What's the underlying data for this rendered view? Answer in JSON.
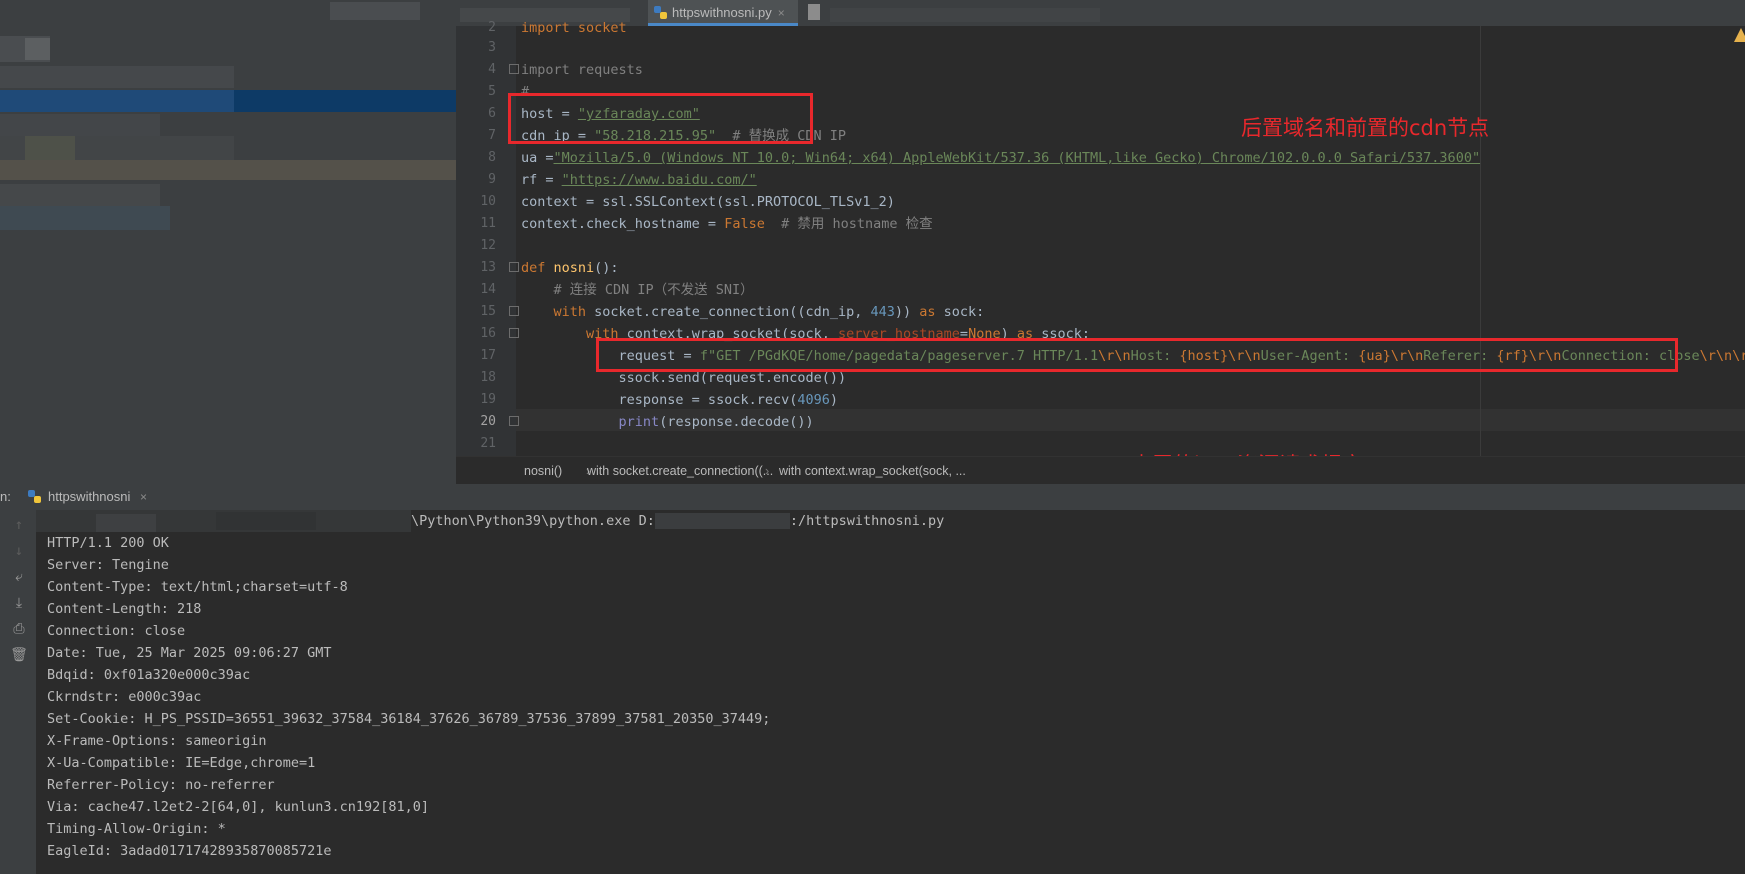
{
  "tabs": {
    "active_file": "httpswithnosni.py",
    "close_glyph": "×"
  },
  "editor": {
    "lines": [
      {
        "num": "3"
      },
      {
        "num": "4"
      },
      {
        "num": "5"
      },
      {
        "num": "6"
      },
      {
        "num": "7"
      },
      {
        "num": "8"
      },
      {
        "num": "9"
      },
      {
        "num": "10"
      },
      {
        "num": "11"
      },
      {
        "num": "12"
      },
      {
        "num": "13"
      },
      {
        "num": "14"
      },
      {
        "num": "15"
      },
      {
        "num": "16"
      },
      {
        "num": "17"
      },
      {
        "num": "18"
      },
      {
        "num": "19"
      },
      {
        "num": "20"
      },
      {
        "num": "21"
      }
    ],
    "code": {
      "l2": "import socket",
      "l4": "import requests",
      "l5": "#",
      "l6_a": "host = ",
      "l6_b": "\"yzfaraday.com\"",
      "l7_a": "cdn_ip = ",
      "l7_b": "\"58.218.215.95\"",
      "l7_c": "  # 替换成 CDN IP",
      "l8_a": "ua =",
      "l8_b": "\"Mozilla/5.0 (Windows NT 10.0; Win64; x64) AppleWebKit/537.36 (KHTML,like Gecko) Chrome/102.0.0.0 Safari/537.3600\"",
      "l9_a": "rf = ",
      "l9_b": "\"https://www.baidu.com/\"",
      "l10": "context = ssl.SSLContext(ssl.PROTOCOL_TLSv1_2)",
      "l11_a": "context.check_hostname = ",
      "l11_b": "False",
      "l11_c": "  # 禁用 hostname 检查",
      "l13_a": "def ",
      "l13_b": "nosni",
      "l13_c": "():",
      "l14": "    # 连接 CDN IP（不发送 SNI）",
      "l15_a": "    with ",
      "l15_b": "socket.create_connection((cdn_ip, ",
      "l15_c": "443",
      "l15_d": ")) ",
      "l15_e": "as ",
      "l15_f": "sock:",
      "l16_a": "        with ",
      "l16_b": "context.wrap_socket(sock, ",
      "l16_c": "server_hostname",
      "l16_d": "=",
      "l16_e": "None",
      "l16_f": ") ",
      "l16_g": "as ",
      "l16_h": "ssock:",
      "l17_a": "            request = ",
      "l17_b": "f\"GET /PGdKQE/home/pagedata/pageserver.7 HTTP/1.1",
      "l17_c": "\\r\\n",
      "l17_d": "Host: ",
      "l17_e": "{host}",
      "l17_f": "\\r\\n",
      "l17_g": "User-Agent: ",
      "l17_h": "{ua}",
      "l17_i": "\\r\\n",
      "l17_j": "Referer: ",
      "l17_k": "{rf}",
      "l17_l": "\\r\\n",
      "l17_m": "Connection: close",
      "l17_n": "\\r\\n\\r\\n",
      "l18": "            ssock.send(request.encode())",
      "l19_a": "            response = ssock.recv(",
      "l19_b": "4096",
      "l19_c": ")",
      "l20_a": "            ",
      "l20_b": "print",
      "l20_c": "(response.decode())"
    }
  },
  "breadcrumb": {
    "items": [
      "nosni()",
      "with socket.create_connection((...",
      "with context.wrap_socket(sock, ..."
    ],
    "separator": "›"
  },
  "annotations": {
    "note1": "后置域名和前置的cdn节点",
    "note2": "内置的http资源请求报文"
  },
  "run_panel": {
    "label": "n:",
    "tab": "httpswithnosni",
    "close_glyph": "×",
    "toolbar_icons": [
      "up-arrow-icon",
      "down-arrow-icon",
      "soft-wrap-icon",
      "scroll-to-end-icon",
      "print-icon",
      "trash-icon"
    ]
  },
  "console": {
    "cmd_a": "\\Python\\Python39\\python.exe D:",
    "cmd_b": ":/httpswithnosni.py",
    "lines": [
      "HTTP/1.1 200 OK",
      "Server: Tengine",
      "Content-Type: text/html;charset=utf-8",
      "Content-Length: 218",
      "Connection: close",
      "Date: Tue, 25 Mar 2025 09:06:27 GMT",
      "Bdqid: 0xf01a320e000c39ac",
      "Ckrndstr: e000c39ac",
      "Set-Cookie: H_PS_PSSID=36551_39632_37584_36184_37626_36789_37536_37899_37581_20350_37449;",
      "X-Frame-Options: sameorigin",
      "X-Ua-Compatible: IE=Edge,chrome=1",
      "Referrer-Policy: no-referrer",
      "Via: cache47.l2et2-2[64,0], kunlun3.cn192[81,0]",
      "Timing-Allow-Origin: *",
      "EagleId: 3adad01717428935870085721e"
    ]
  },
  "colors": {
    "annotation_red": "#e8282c",
    "editor_bg": "#2b2b2b",
    "panel_bg": "#3c3f41"
  }
}
